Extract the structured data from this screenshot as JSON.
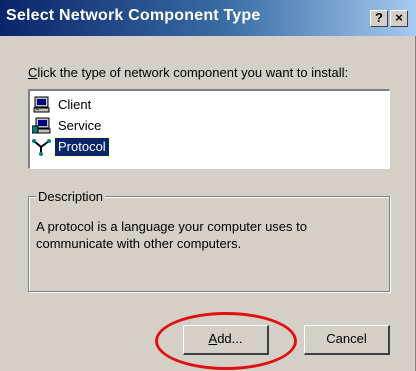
{
  "window": {
    "title": "Select Network Component Type",
    "help_label": "?",
    "close_label": "×"
  },
  "instruction": {
    "accel": "C",
    "rest": "lick the type of network component you want to install:"
  },
  "components": [
    {
      "label": "Client",
      "icon": "client-computer-icon",
      "selected": false
    },
    {
      "label": "Service",
      "icon": "service-computer-icon",
      "selected": false
    },
    {
      "label": "Protocol",
      "icon": "protocol-network-icon",
      "selected": true
    }
  ],
  "description": {
    "legend": "Description",
    "text": "A protocol is a language your computer uses to communicate with other computers."
  },
  "buttons": {
    "add_accel": "A",
    "add_rest": "dd...",
    "cancel": "Cancel"
  },
  "annotation": {
    "color": "#e01010",
    "target": "add-button"
  }
}
